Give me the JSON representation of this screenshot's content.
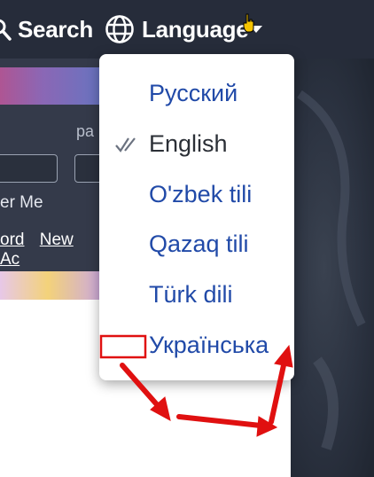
{
  "nav": {
    "search_label": "Search",
    "search_icon": "search-icon",
    "language_label": "Language",
    "language_icon": "globe-icon"
  },
  "login": {
    "password_label_partial": "pa",
    "remember_partial": "er Me",
    "link_password_partial": "ord",
    "link_new_account_partial": "New Ac"
  },
  "language_menu": {
    "items": [
      {
        "label": "Русский",
        "selected": false
      },
      {
        "label": "English",
        "selected": true
      },
      {
        "label": "O'zbek tili",
        "selected": false
      },
      {
        "label": "Qazaq tili",
        "selected": false
      },
      {
        "label": "Türk dili",
        "selected": false
      },
      {
        "label": "Українська",
        "selected": false
      }
    ]
  },
  "colors": {
    "topbar": "#262c3a",
    "link_blue": "#214aa8",
    "annotation_red": "#e01010"
  }
}
